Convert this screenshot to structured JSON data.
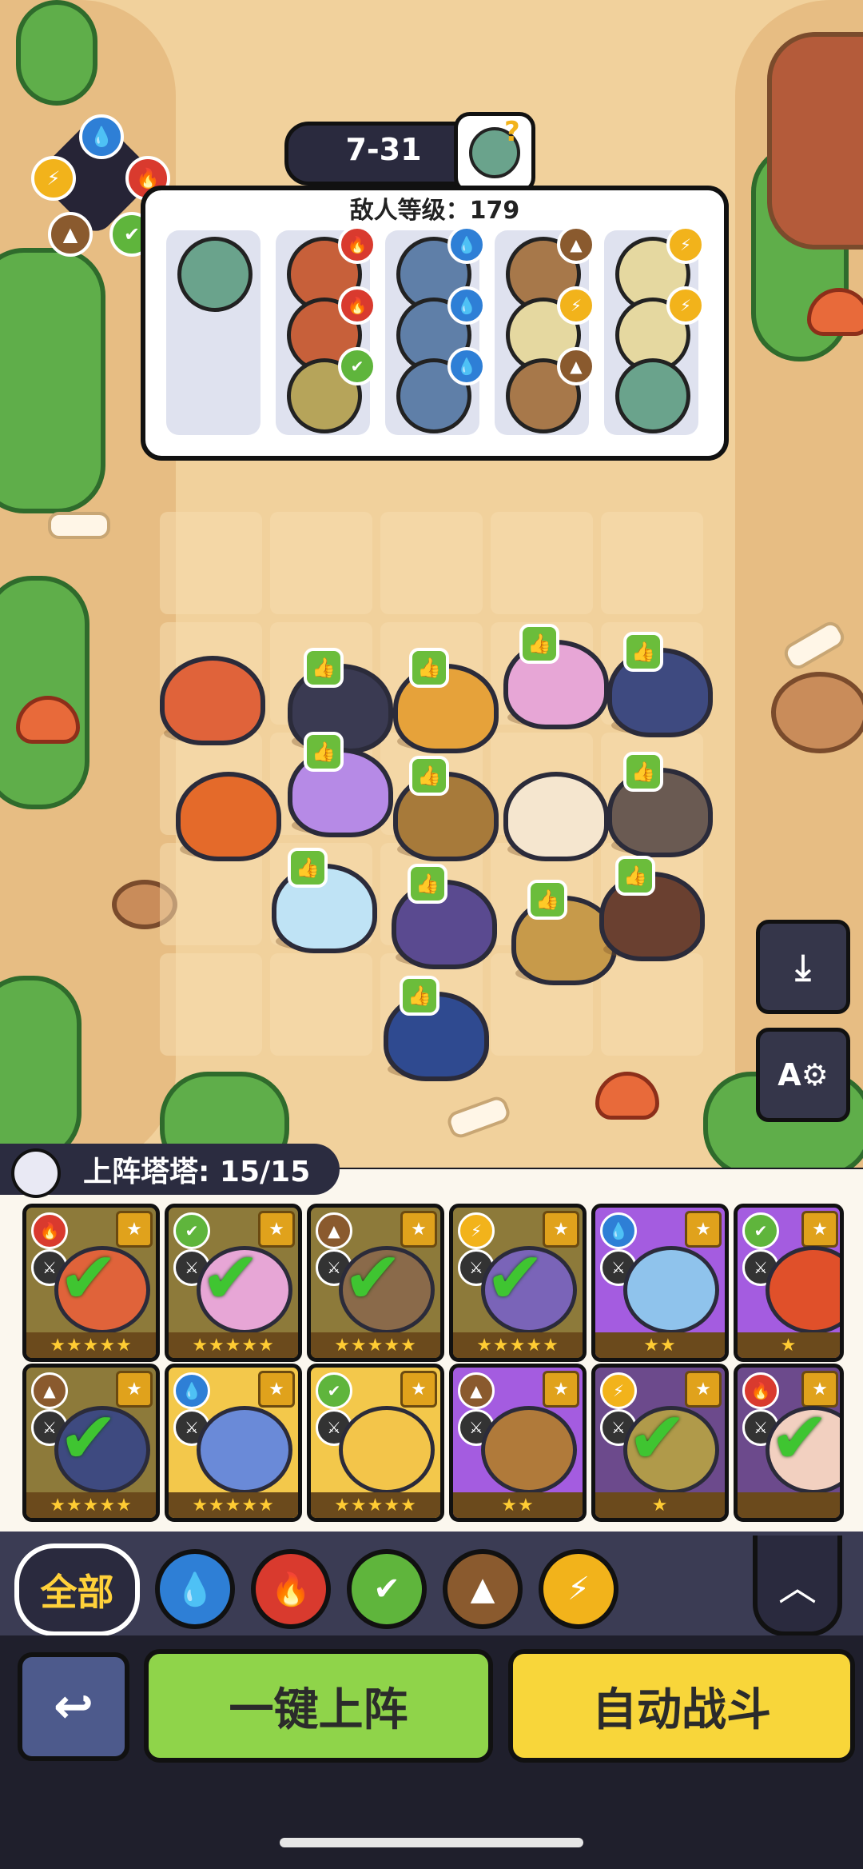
{
  "level": {
    "stage": "7-31"
  },
  "enemy": {
    "title": "敌人等级：179",
    "columns": [
      {
        "monsters": [
          "zombie"
        ],
        "badges": []
      },
      {
        "monsters": [
          "fire-zombie",
          "fire-zombie",
          "grass-zombie"
        ],
        "badges": [
          "fire",
          "fire",
          "grass"
        ]
      },
      {
        "monsters": [
          "water-zombie",
          "water-zombie",
          "water-zombie"
        ],
        "badges": [
          "water",
          "water",
          "water"
        ]
      },
      {
        "monsters": [
          "earth-zombie",
          "light-zombie",
          "earth-zombie"
        ],
        "badges": [
          "earth",
          "light",
          "earth"
        ]
      },
      {
        "monsters": [
          "light-zombie",
          "light-zombie",
          "zombie"
        ],
        "badges": [
          "light",
          "light",
          ""
        ]
      }
    ]
  },
  "element_glyphs": {
    "water": "💧",
    "fire": "🔥",
    "grass": "✔",
    "earth": "▲",
    "light": "⚡"
  },
  "colors": {
    "water": "#2e7fd6",
    "fire": "#d93a2e",
    "grass": "#5fb53c",
    "earth": "#8a5a2e",
    "light": "#f2b31b"
  },
  "deploy": {
    "label": "上阵塔塔: 15/15"
  },
  "cards_row1": [
    {
      "element": "fire",
      "rarity": "gold",
      "selected": true,
      "stars": "★★★★★"
    },
    {
      "element": "grass",
      "rarity": "gold",
      "selected": true,
      "stars": "★★★★★"
    },
    {
      "element": "earth",
      "rarity": "gold",
      "selected": true,
      "stars": "★★★★★"
    },
    {
      "element": "light",
      "rarity": "gold",
      "selected": true,
      "stars": "★★★★★"
    },
    {
      "element": "water",
      "rarity": "purple",
      "selected": false,
      "stars": "★★"
    },
    {
      "element": "grass",
      "rarity": "purple",
      "selected": false,
      "stars": "★"
    }
  ],
  "cards_row2": [
    {
      "element": "earth",
      "rarity": "gold",
      "selected": true,
      "stars": "★★★★★"
    },
    {
      "element": "water",
      "rarity": "gold",
      "selected": false,
      "stars": "★★★★★"
    },
    {
      "element": "grass",
      "rarity": "gold",
      "selected": false,
      "stars": "★★★★★"
    },
    {
      "element": "earth",
      "rarity": "purple",
      "selected": false,
      "stars": "★★"
    },
    {
      "element": "light",
      "rarity": "purple",
      "selected": true,
      "stars": "★"
    },
    {
      "element": "fire",
      "rarity": "purple",
      "selected": true,
      "stars": ""
    }
  ],
  "filters": {
    "all_label": "全部",
    "items": [
      "water",
      "fire",
      "grass",
      "earth",
      "light"
    ]
  },
  "buttons": {
    "back": "↩",
    "deploy_all": "一键上阵",
    "auto_battle": "自动战斗",
    "expand": "︿",
    "download": "⤓",
    "auto_text": "A⚙"
  }
}
